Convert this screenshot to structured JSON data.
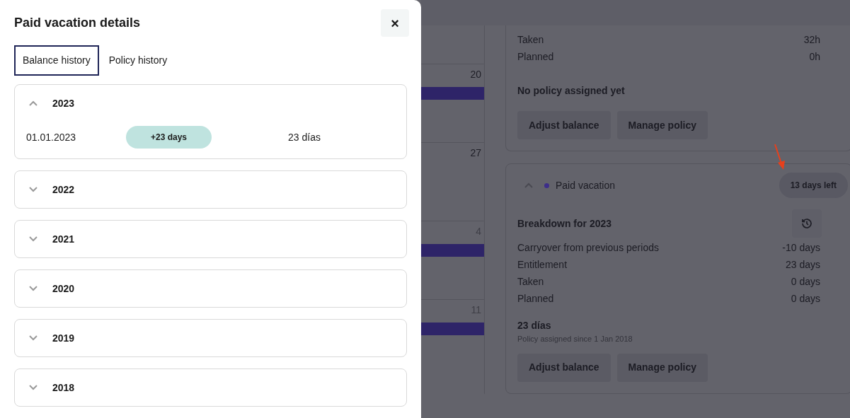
{
  "drawer": {
    "title": "Paid vacation details",
    "close": "×",
    "tabs": [
      {
        "label": "Balance history",
        "selected": true
      },
      {
        "label": "Policy history",
        "selected": false
      }
    ],
    "years": [
      {
        "year": "2023",
        "expanded": true,
        "entries": [
          {
            "date": "01.01.2023",
            "change": "+23 days",
            "balance": "23 días"
          }
        ]
      },
      {
        "year": "2022",
        "expanded": false
      },
      {
        "year": "2021",
        "expanded": false
      },
      {
        "year": "2020",
        "expanded": false
      },
      {
        "year": "2019",
        "expanded": false
      },
      {
        "year": "2018",
        "expanded": false
      }
    ]
  },
  "calendar": {
    "days": [
      {
        "label": "20",
        "muted": false,
        "bar": true
      },
      {
        "label": "27",
        "muted": false,
        "bar": false
      },
      {
        "label": "4",
        "muted": true,
        "bar": true
      },
      {
        "label": "11",
        "muted": true,
        "bar": true
      }
    ]
  },
  "hours_card": {
    "rows": [
      {
        "label": "Taken",
        "value": "32h"
      },
      {
        "label": "Planned",
        "value": "0h"
      }
    ],
    "policy_title": "No policy assigned yet",
    "buttons": [
      "Adjust balance",
      "Manage policy"
    ]
  },
  "vacation_card": {
    "title": "Paid vacation",
    "expanded": true,
    "color": "#3d2e8a",
    "badge": "13 days left",
    "breakdown_title": "Breakdown for 2023",
    "rows": [
      {
        "label": "Carryover from previous periods",
        "value": "-10 days"
      },
      {
        "label": "Entitlement",
        "value": "23 days"
      },
      {
        "label": "Taken",
        "value": "0 days"
      },
      {
        "label": "Planned",
        "value": "0 days"
      }
    ],
    "policy_title": "23 días",
    "policy_note": "Policy assigned since 1 Jan 2018",
    "buttons": [
      "Adjust balance",
      "Manage policy"
    ]
  }
}
